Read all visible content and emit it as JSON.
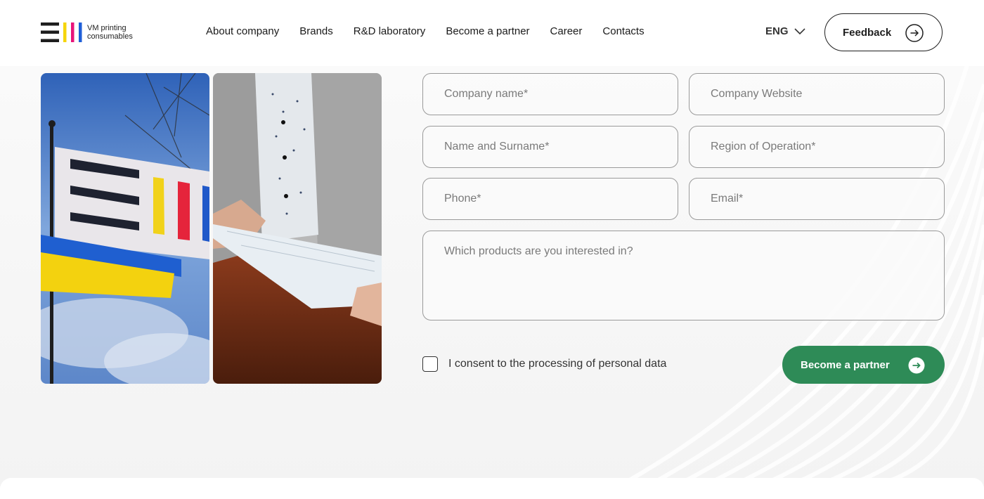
{
  "brand": {
    "name_line1": "VM printing",
    "name_line2": "consumables",
    "colors": {
      "dark": "#1e1e1e",
      "yellow": "#f5d50c",
      "magenta": "#e8147a",
      "blue": "#1f5fd8"
    }
  },
  "nav": {
    "items": [
      {
        "label": "About company"
      },
      {
        "label": "Brands"
      },
      {
        "label": "R&D laboratory"
      },
      {
        "label": "Become a partner"
      },
      {
        "label": "Career"
      },
      {
        "label": "Contacts"
      }
    ]
  },
  "language": {
    "selected": "ENG",
    "icon": "chevron-down-icon"
  },
  "feedback": {
    "label": "Feedback",
    "icon": "arrow-right-circle-icon"
  },
  "form": {
    "company_name": {
      "placeholder": "Company name*",
      "value": ""
    },
    "company_website": {
      "placeholder": "Company Website",
      "value": ""
    },
    "full_name": {
      "placeholder": "Name and Surname*",
      "value": ""
    },
    "region": {
      "placeholder": "Region of Operation*",
      "value": ""
    },
    "phone": {
      "placeholder": "Phone*",
      "value": ""
    },
    "email": {
      "placeholder": "Email*",
      "value": ""
    },
    "products": {
      "placeholder": "Which products are you interested in?",
      "value": ""
    },
    "consent_label": "I consent to the processing of personal data",
    "consent_checked": false,
    "submit_label": "Become a partner",
    "submit_color": "#2e8b57"
  }
}
